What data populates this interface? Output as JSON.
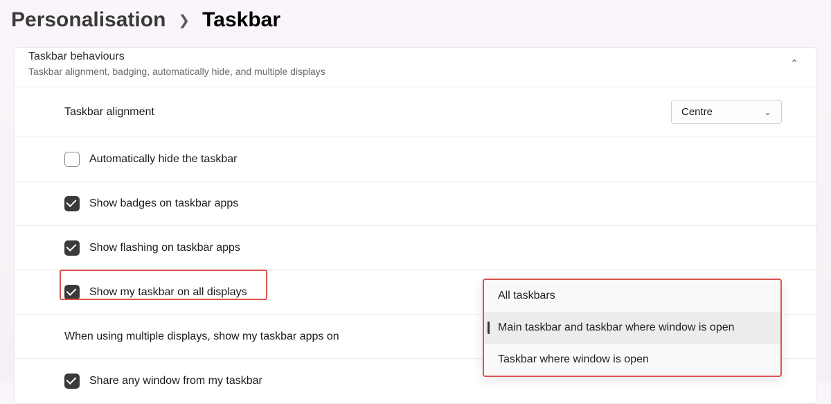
{
  "breadcrumb": {
    "parent": "Personalisation",
    "current": "Taskbar"
  },
  "section": {
    "title": "Taskbar behaviours",
    "subtitle": "Taskbar alignment, badging, automatically hide, and multiple displays"
  },
  "alignment": {
    "label": "Taskbar alignment",
    "value": "Centre"
  },
  "options": {
    "auto_hide": "Automatically hide the taskbar",
    "badges": "Show badges on taskbar apps",
    "flashing": "Show flashing on taskbar apps",
    "all_displays": "Show my taskbar on all displays",
    "multi_label": "When using multiple displays, show my taskbar apps on",
    "share_window": "Share any window from my taskbar"
  },
  "flyout": {
    "items": [
      "All taskbars",
      "Main taskbar and taskbar where window is open",
      "Taskbar where window is open"
    ]
  }
}
